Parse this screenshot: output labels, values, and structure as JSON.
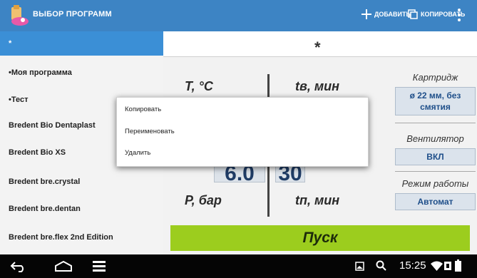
{
  "app": {
    "title": "ВЫБОР ПРОГРАММ",
    "add_label": "ДОБАВИТЬ",
    "copy_label": "КОПИРОВАТЬ"
  },
  "programs": [
    "*",
    "•Моя программа",
    "•Тест",
    "Bredent Bio Dentaplast",
    "Bredent Bio XS",
    "Bredent bre.crystal",
    "Bredent bre.dentan",
    "Bredent bre.flex 2nd Edition"
  ],
  "detail": {
    "header": "*",
    "temp_label": "T, °C",
    "heat_time_label": "tв, мин",
    "pressure_label": "P, бар",
    "press_time_label": "tп, мин",
    "pressure_value": "6.0",
    "press_time_value": "30",
    "cartridge_label": "Картридж",
    "cartridge_value": "ø 22 мм, без смятия",
    "fan_label": "Вентилятор",
    "fan_value": "ВКЛ",
    "mode_label": "Режим работы",
    "mode_value": "Автомат",
    "start_label": "Пуск"
  },
  "context_menu": [
    "Копировать",
    "Переименовать",
    "Удалить"
  ],
  "status": {
    "time": "15:25"
  }
}
